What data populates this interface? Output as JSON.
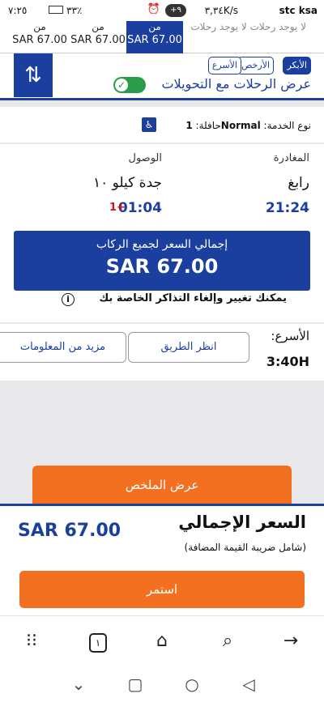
{
  "status_bar": {
    "carrier": "stc ksa",
    "network_speed": "٣,٣٤K/s",
    "notification_count": "+٩",
    "time": "٧:٢٥",
    "battery_percent": "٣٣٪"
  },
  "date_tabs": {
    "ghost_text": "لا يوجد رحلات لا يوجد رحلات",
    "tabs": [
      {
        "from_label": "من",
        "price": "SAR 67.00",
        "active": true
      },
      {
        "from_label": "من",
        "price": "SAR 67.00",
        "active": false
      },
      {
        "from_label": "من",
        "price": "SAR 67.00",
        "active": false
      }
    ]
  },
  "filters": {
    "sort_options": [
      "الأبكر",
      "الأرخص",
      "الأسرع"
    ],
    "active_sort": "الأبكر",
    "transfers_label": "عرض الرحلات مع التحويلات",
    "transfers_enabled": true,
    "swap_icon": "swap-vertical-icon"
  },
  "service": {
    "label": "نوع الخدمة:",
    "service_type": "Normal",
    "bus_label": "حافلة:",
    "bus_count": "1",
    "accessibility_icon": "wheelchair-icon"
  },
  "trip": {
    "departure_label": "المغادرة",
    "arrival_label": "الوصول",
    "departure_city": "رابغ",
    "arrival_city": "جدة كيلو ١٠",
    "departure_time": "21:24",
    "arrival_time": "01:04",
    "arrival_day_offset": "1+",
    "total_price_label": "إجمالي السعر لجميع الركاب",
    "total_price": "SAR  67.00",
    "change_note": "يمكنك تغيير وإلغاء التذاكر الخاصة بك"
  },
  "fastest": {
    "label": "الأسرع:",
    "duration": "3:40H",
    "route_button": "انظر الطريق",
    "more_info_button": "مزيد من المعلومات"
  },
  "summary_button": "عرض الملخص",
  "totals": {
    "label": "السعر الإجمالي",
    "vat_note": "(شامل ضريبة القيمة المضافة)",
    "amount": "SAR  67.00",
    "continue_button": "استمر"
  },
  "browser_nav": {
    "tab_count": "١"
  },
  "colors": {
    "primary": "#1a3f9e",
    "accent": "#f37021",
    "toggle_on": "#2a9d4a",
    "alert": "#dd1111"
  }
}
